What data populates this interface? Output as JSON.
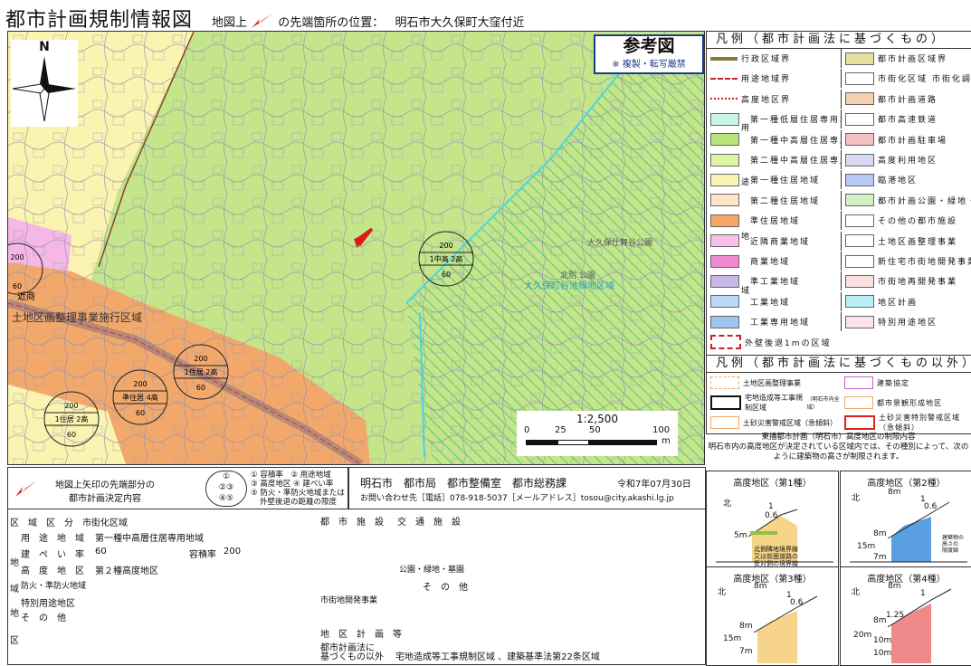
{
  "header": {
    "title": "都市計画規制情報図",
    "location_prefix": "地図上",
    "location_suffix": "の先端箇所の位置：",
    "location": "明石市大久保町大窪付近"
  },
  "reference": {
    "label": "参考図",
    "note": "※ 複製・転写厳禁"
  },
  "map": {
    "north_label": "N",
    "labels": {
      "zone_circle_1": [
        "200",
        "1中高 2高",
        "60"
      ],
      "zone_circle_2": [
        "200",
        "1住居 2高",
        "60"
      ],
      "zone_circle_3": [
        "200",
        "準住居 4高",
        "60"
      ],
      "zone_circle_4": [
        "200",
        "1住居 2高",
        "60"
      ],
      "zone_circle_5": [
        "200",
        "",
        "60"
      ],
      "kinsho": "近商",
      "kukaku": "土地区画整理事業施行区域",
      "park": "大久保町谷池緑地区域",
      "kouen_name": "大久保仕舞谷公園",
      "hoka": "北別 公園"
    },
    "scale": {
      "ratio": "1:2,500",
      "ticks": [
        "0",
        "25",
        "50",
        "100"
      ],
      "unit": "m"
    },
    "colors": {
      "green": "#c4e58a",
      "orange": "#f2a86b",
      "yellow": "#fbf3b0",
      "pink": "#f5b7e5",
      "hatch": "#3fbf7f",
      "cyan": "#4bd5e0",
      "red_arrow": "#d81a1a"
    }
  },
  "legend": {
    "title": "凡例（都市計画法に基づくもの）",
    "left": [
      {
        "label": "行政区域界",
        "swatch": "line-olive"
      },
      {
        "label": "用途地域界",
        "swatch": "line-red-dash"
      },
      {
        "label": "高度地区界",
        "swatch": "line-red-plus"
      },
      {
        "label": "第一種低層住居専用地域",
        "color": "#c8f3e6"
      },
      {
        "label": "第一種中高層住居専用地域",
        "color": "#b8e27a"
      },
      {
        "label": "第二種中高層住居専用地域",
        "color": "#dff5a6"
      },
      {
        "label": "第一種住居地域",
        "color": "#fbf5b4"
      },
      {
        "label": "第二種住居地域",
        "color": "#fde4c8"
      },
      {
        "label": "準住居地域",
        "color": "#f6a765"
      },
      {
        "label": "近隣商業地域",
        "color": "#f7c0e8"
      },
      {
        "label": "商業地域",
        "color": "#f08ad0"
      },
      {
        "label": "準工業地域",
        "color": "#c9b8e6"
      },
      {
        "label": "工業地域",
        "color": "#b8d8f5"
      },
      {
        "label": "工業専用地域",
        "color": "#9fc4ef"
      },
      {
        "label": "外壁後退1mの区域",
        "swatch": "dash-red"
      }
    ],
    "group_label": [
      "用",
      "途",
      "地",
      "域"
    ],
    "right": [
      {
        "label": "都市計画区域界",
        "color": "#e8e0a0"
      },
      {
        "label": "市街化区域 市街化調整区域",
        "color": "#fff"
      },
      {
        "label": "都市計画道路",
        "color": "#f7d0b0"
      },
      {
        "label": "都市高速鉄道",
        "color": "#fff"
      },
      {
        "label": "都市計画駐車場",
        "color": "#f5c0c0"
      },
      {
        "label": "高度利用地区",
        "color": "#d8d8f5"
      },
      {
        "label": "臨港地区",
        "color": "#b8c8f5"
      },
      {
        "label": "都市計画公園・緑地・墓園",
        "color": "#d5f0c5"
      },
      {
        "label": "その他の都市施設",
        "color": "#fff"
      },
      {
        "label": "土地区画整理事業",
        "color": "#fff"
      },
      {
        "label": "新住宅市街地開発事業",
        "color": "#fff"
      },
      {
        "label": "市街地再開発事業",
        "color": "#fbe0e0"
      },
      {
        "label": "地区計画",
        "color": "#b8eef5"
      },
      {
        "label": "特別用途地区",
        "color": "#fce0ee"
      }
    ],
    "title2": "凡例（都市計画法に基づくもの以外）",
    "other_left": [
      {
        "label": "土地区画整理事業"
      },
      {
        "label": "宅地造成等工事規制区域",
        "sub": "（明石市内全域）"
      },
      {
        "label": "土砂災害警戒区域（急傾斜）"
      }
    ],
    "other_right": [
      {
        "label": "建築協定"
      },
      {
        "label": "都市景観形成地区"
      },
      {
        "label": "土砂災害特別警戒区域（急傾斜）"
      }
    ],
    "note": [
      "東播都市計画（明石市）高度地区の制限内容",
      "明石市内の高度地区が決定されている区域内では、その種別によって、次のように建築物の高さが制限されます。"
    ]
  },
  "bottom": {
    "arrow_caption": [
      "地図上矢印の先端部分の",
      "都市計画決定内容"
    ],
    "circle_key": [
      "①",
      "②③",
      "④⑤"
    ],
    "circle_desc": [
      "① 容積率　② 用途地域",
      "③ 高度地区 ④ 建ぺい率",
      "⑤ 防火・準防火地域または",
      "外壁後退の距離の限度"
    ],
    "org": "明石市　都市局　都市整備室　都市総務課",
    "date": "令和7年07月30日",
    "contact": "お問い合わせ先［電話］078-918-5037［メールアドレス］tosou@city.akashi.lg.jp"
  },
  "info": {
    "area_label": "区　域　区　分",
    "area_value": "市街化区域",
    "use_label": "用　途　地　域",
    "use_value": "第一種中高層住居専用地域",
    "coverage_label": "建　ぺ　い　率",
    "coverage_value": "60",
    "far_label": "容積率",
    "far_value": "200",
    "height_label": "高　度　地　区",
    "height_value": "第２種高度地区",
    "fire_value": "防火・準防火地域",
    "special_label": "特別用途地区",
    "other_label": "そ　の　他",
    "side_chars": [
      "地",
      "域",
      "地",
      "区"
    ],
    "facility_label": "都　市　施　設",
    "traffic_label": "交　通　施　設",
    "park_label": "公園・緑地・墓園",
    "sonota": "そ　の　他",
    "redev_label": "市街地開発事業",
    "district_label": "地　区　計　画　等",
    "nonplan_label": [
      "都市計画法に",
      "基づくもの以外"
    ],
    "nonplan_value": "宅地造成等工事規制区域 、建築基準法第22条区域"
  },
  "height_districts": [
    {
      "title": "高度地区（第1種）",
      "vals": [
        "北",
        "1",
        "0.6",
        "5m"
      ],
      "notes": [
        "北側隣地境界線",
        "又は前面道路の",
        "反対側の境界線"
      ]
    },
    {
      "title": "高度地区（第2種）",
      "vals": [
        "北",
        "8m",
        "1",
        "0.6",
        "8m",
        "15m",
        "7m"
      ],
      "notes": [
        "建築物の",
        "高さの",
        "限度線"
      ]
    },
    {
      "title": "高度地区（第3種）",
      "vals": [
        "北",
        "8m",
        "1",
        "0.6",
        "8m",
        "15m",
        "7m"
      ]
    },
    {
      "title": "高度地区（第4種）",
      "vals": [
        "北",
        "8m",
        "1",
        "1.25",
        "8m",
        "20m",
        "10m",
        "10m"
      ]
    }
  ]
}
